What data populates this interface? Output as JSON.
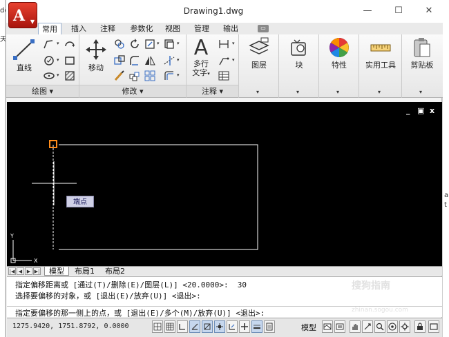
{
  "background_fragments": {
    "left": [
      "de",
      "天"
    ],
    "right": [
      "ar",
      "t"
    ]
  },
  "window": {
    "title": "Drawing1.dwg",
    "app_button_glyph": "A",
    "controls": {
      "minimize": "—",
      "maximize": "☐",
      "close": "✕"
    }
  },
  "ribbon": {
    "tabs": [
      "常用",
      "插入",
      "注释",
      "参数化",
      "视图",
      "管理",
      "输出"
    ],
    "active_tab": "常用",
    "extra_tab": "▭",
    "panels": {
      "draw": {
        "title": "绘图",
        "line_label": "直线"
      },
      "modify": {
        "title": "修改",
        "move_label": "移动"
      },
      "annotation": {
        "title": "注释",
        "text_label_line1": "多行",
        "text_label_line2": "文字"
      },
      "layers": {
        "label": "图层"
      },
      "block": {
        "label": "块"
      },
      "properties": {
        "label": "特性"
      },
      "utilities": {
        "label": "实用工具"
      },
      "clipboard": {
        "label": "剪贴板"
      }
    },
    "dropdown_glyph": "▾"
  },
  "canvas": {
    "tooltip": "端点",
    "controls": {
      "minimize": "_",
      "restore": "▣",
      "close": "x"
    },
    "ucs": {
      "x_label": "X",
      "y_label": "Y"
    }
  },
  "layout_tabs": {
    "nav": [
      "|◀",
      "◀",
      "▶",
      "▶|"
    ],
    "tabs": [
      "模型",
      "布局1",
      "布局2"
    ],
    "active": "模型"
  },
  "command_line": {
    "history": [
      "指定偏移距离或 [通过(T)/删除(E)/图层(L)] <20.0000>:  30",
      "选择要偏移的对象，或 [退出(E)/放弃(U)] <退出>:"
    ],
    "current": "指定要偏移的那一侧上的点，或 [退出(E)/多个(M)/放弃(U)] <退出>:"
  },
  "status_bar": {
    "coordinates": "1275.9420, 1751.8792, 0.0000",
    "model_label": "模型"
  },
  "watermark": {
    "text": "搜狗指南",
    "sub": "zhinan.sogou.com"
  },
  "colors": {
    "canvas_bg": "#000000",
    "geometry": "#ffffff",
    "snap_marker": "#ff8c1a",
    "app_button": "#c9261a",
    "ribbon_active_border": "#9ab1cf"
  }
}
